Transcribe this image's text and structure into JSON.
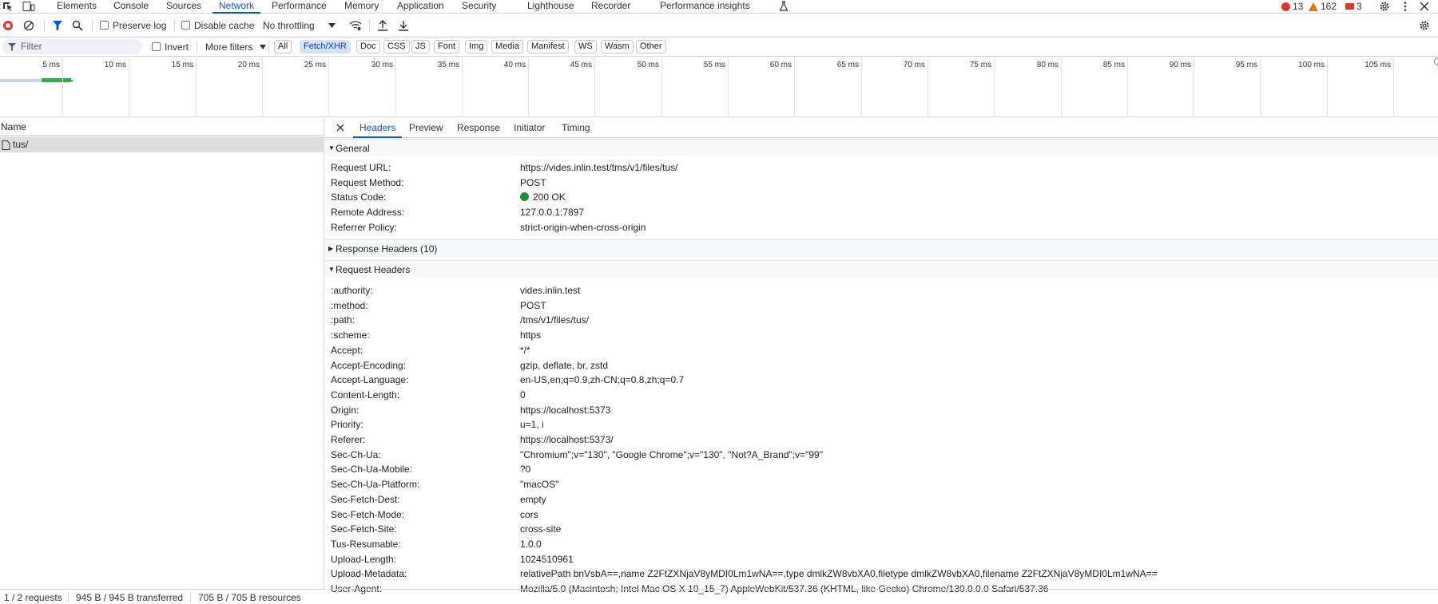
{
  "tabs": [
    "Elements",
    "Console",
    "Sources",
    "Network",
    "Performance",
    "Memory",
    "Application",
    "Security",
    "Lighthouse",
    "Recorder",
    "Performance insights"
  ],
  "active_tab": "Network",
  "counters": {
    "errors": "13",
    "warnings": "162",
    "issues": "3"
  },
  "toolbar": {
    "preserve_log": "Preserve log",
    "disable_cache": "Disable cache",
    "throttling": "No throttling"
  },
  "filterbar": {
    "filter_placeholder": "Filter",
    "invert": "Invert",
    "more_filters": "More filters",
    "chips": [
      "All",
      "Fetch/XHR",
      "Doc",
      "CSS",
      "JS",
      "Font",
      "Img",
      "Media",
      "Manifest",
      "WS",
      "Wasm",
      "Other"
    ],
    "selected_chip": "Fetch/XHR"
  },
  "timeline": {
    "ticks": [
      "5 ms",
      "10 ms",
      "15 ms",
      "20 ms",
      "25 ms",
      "30 ms",
      "35 ms",
      "40 ms",
      "45 ms",
      "50 ms",
      "55 ms",
      "60 ms",
      "65 ms",
      "70 ms",
      "75 ms",
      "80 ms",
      "85 ms",
      "90 ms",
      "95 ms",
      "100 ms",
      "105 ms"
    ]
  },
  "request_list": {
    "header": "Name",
    "rows": [
      "tus/"
    ]
  },
  "details": {
    "tabs": [
      "Headers",
      "Preview",
      "Response",
      "Initiator",
      "Timing"
    ],
    "active_tab": "Headers",
    "general_title": "General",
    "general": [
      {
        "key": "Request URL:",
        "value": "https://vides.inlin.test/tms/v1/files/tus/"
      },
      {
        "key": "Request Method:",
        "value": "POST"
      },
      {
        "key": "Status Code:",
        "value": "200 OK"
      },
      {
        "key": "Remote Address:",
        "value": "127.0.0.1:7897"
      },
      {
        "key": "Referrer Policy:",
        "value": "strict-origin-when-cross-origin"
      }
    ],
    "response_headers_title": "Response Headers (10)",
    "request_headers_title": "Request Headers",
    "request_headers": [
      {
        "key": ":authority:",
        "value": "vides.inlin.test"
      },
      {
        "key": ":method:",
        "value": "POST"
      },
      {
        "key": ":path:",
        "value": "/tms/v1/files/tus/"
      },
      {
        "key": ":scheme:",
        "value": "https"
      },
      {
        "key": "Accept:",
        "value": "*/*"
      },
      {
        "key": "Accept-Encoding:",
        "value": "gzip, deflate, br, zstd"
      },
      {
        "key": "Accept-Language:",
        "value": "en-US,en;q=0.9,zh-CN;q=0.8,zh;q=0.7"
      },
      {
        "key": "Content-Length:",
        "value": "0"
      },
      {
        "key": "Origin:",
        "value": "https://localhost:5373"
      },
      {
        "key": "Priority:",
        "value": "u=1, i"
      },
      {
        "key": "Referer:",
        "value": "https://localhost:5373/"
      },
      {
        "key": "Sec-Ch-Ua:",
        "value": "\"Chromium\";v=\"130\", \"Google Chrome\";v=\"130\", \"Not?A_Brand\";v=\"99\""
      },
      {
        "key": "Sec-Ch-Ua-Mobile:",
        "value": "?0"
      },
      {
        "key": "Sec-Ch-Ua-Platform:",
        "value": "\"macOS\""
      },
      {
        "key": "Sec-Fetch-Dest:",
        "value": "empty"
      },
      {
        "key": "Sec-Fetch-Mode:",
        "value": "cors"
      },
      {
        "key": "Sec-Fetch-Site:",
        "value": "cross-site"
      },
      {
        "key": "Tus-Resumable:",
        "value": "1.0.0"
      },
      {
        "key": "Upload-Length:",
        "value": "1024510961"
      },
      {
        "key": "Upload-Metadata:",
        "value": "relativePath bnVsbA==,name Z2FtZXNjaV8yMDI0Lm1wNA==,type dmlkZW8vbXA0,filetype dmlkZW8vbXA0,filename Z2FtZXNjaV8yMDI0Lm1wNA=="
      },
      {
        "key": "User-Agent:",
        "value": "Mozilla/5.0 (Macintosh; Intel Mac OS X 10_15_7) AppleWebKit/537.36 (KHTML, like Gecko) Chrome/130.0.0.0 Safari/537.36"
      }
    ]
  },
  "statusbar": {
    "requests": "1 / 2 requests",
    "transferred": "945 B / 945 B transferred",
    "resources": "705 B / 705 B resources"
  },
  "colors": {
    "accent": "#0b57d0",
    "error": "#dc362e",
    "warning": "#e37400",
    "status_ok": "#1e8e3e"
  }
}
